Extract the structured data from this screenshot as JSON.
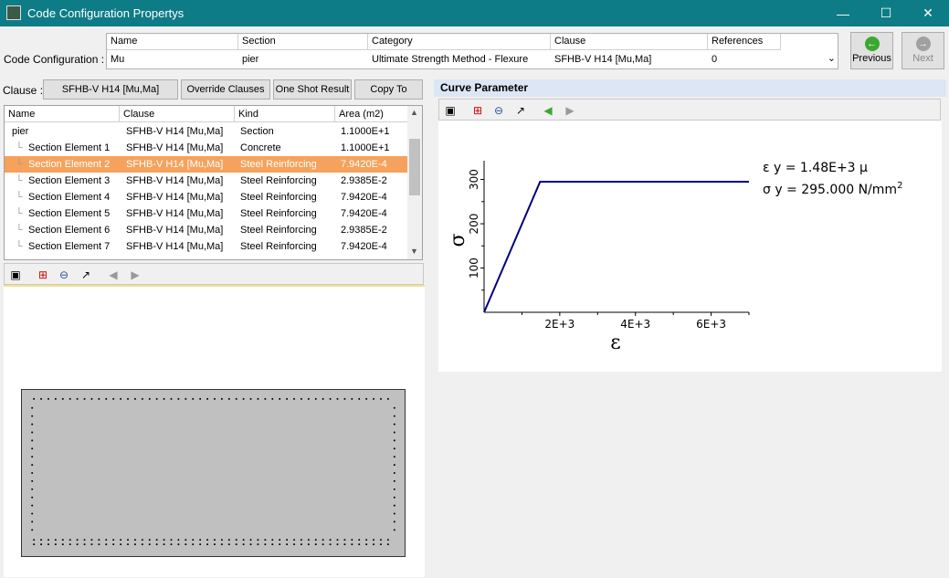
{
  "window": {
    "title": "Code Configuration Propertys",
    "minimize": "—",
    "maximize": "☐",
    "close": "✕"
  },
  "code_config": {
    "label": "Code Configuration :",
    "headers": [
      "Name",
      "Section",
      "Category",
      "Clause",
      "References"
    ],
    "values": [
      "Mu",
      "pier",
      "Ultimate Strength Method - Flexure",
      "SFHB-V H14 [Mu,Ma]",
      "0"
    ]
  },
  "nav": {
    "previous": "Previous",
    "next": "Next"
  },
  "clause_bar": {
    "label": "Clause :",
    "clause_button": "SFHB-V H14 [Mu,Ma]",
    "override_button": "Override Clauses",
    "one_shot_button": "One Shot Result",
    "copy_button": "Copy To"
  },
  "table": {
    "headers": [
      "Name",
      "Clause",
      "Kind",
      "Area (m2)"
    ],
    "rows": [
      {
        "name": "pier",
        "clause": "SFHB-V H14 [Mu,Ma]",
        "kind": "Section",
        "area": "1.1000E+1"
      },
      {
        "name": "Section Element 1",
        "clause": "SFHB-V H14 [Mu,Ma]",
        "kind": "Concrete",
        "area": "1.1000E+1"
      },
      {
        "name": "Section Element 2",
        "clause": "SFHB-V H14 [Mu,Ma]",
        "kind": "Steel Reinforcing",
        "area": "7.9420E-4"
      },
      {
        "name": "Section Element 3",
        "clause": "SFHB-V H14 [Mu,Ma]",
        "kind": "Steel Reinforcing",
        "area": "2.9385E-2"
      },
      {
        "name": "Section Element 4",
        "clause": "SFHB-V H14 [Mu,Ma]",
        "kind": "Steel Reinforcing",
        "area": "7.9420E-4"
      },
      {
        "name": "Section Element 5",
        "clause": "SFHB-V H14 [Mu,Ma]",
        "kind": "Steel Reinforcing",
        "area": "7.9420E-4"
      },
      {
        "name": "Section Element 6",
        "clause": "SFHB-V H14 [Mu,Ma]",
        "kind": "Steel Reinforcing",
        "area": "2.9385E-2"
      },
      {
        "name": "Section Element 7",
        "clause": "SFHB-V H14 [Mu,Ma]",
        "kind": "Steel Reinforcing",
        "area": "7.9420E-4"
      }
    ],
    "selected_index": 2
  },
  "curve": {
    "header": "Curve Parameter",
    "eps_y_label": "ε y = 1.48E+3  μ",
    "sigma_y_label": "σ y = 295.000 N/mm",
    "sigma_y_exp": "2"
  },
  "chart_data": {
    "type": "line",
    "xlabel": "ε",
    "ylabel": "σ",
    "xticks": [
      "2E+3",
      "4E+3",
      "6E+3"
    ],
    "yticks": [
      "100",
      "200",
      "300"
    ],
    "xlim": [
      0,
      7000
    ],
    "ylim": [
      0,
      330
    ],
    "series": [
      {
        "x": [
          0,
          1480,
          7000
        ],
        "y": [
          0,
          295,
          295
        ]
      }
    ]
  },
  "colors": {
    "titlebar": "#0e7c86",
    "selected_row": "#f6a25c",
    "curve": "#000080",
    "previous_icon": "#3aa830",
    "next_icon": "#a0a0a0"
  }
}
